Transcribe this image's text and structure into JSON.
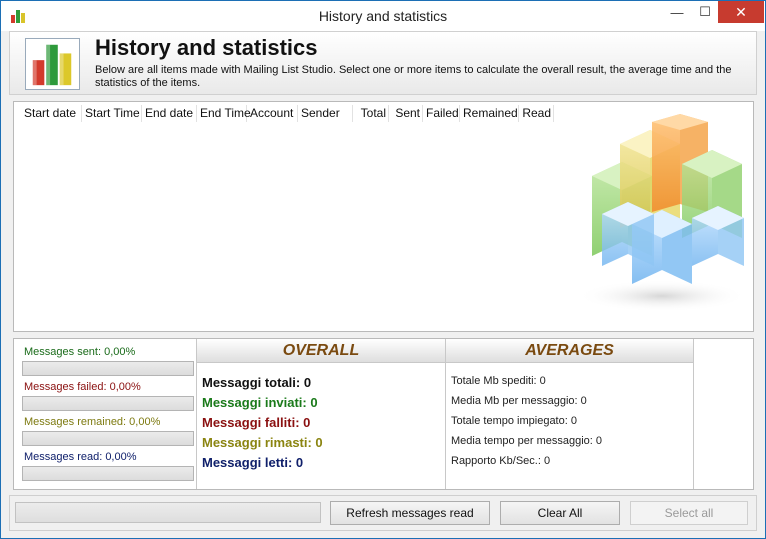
{
  "window": {
    "title": "History and statistics",
    "minimize": "—",
    "maximize": "☐",
    "close": "✕"
  },
  "header": {
    "title": "History and statistics",
    "description": "Below are all items made with Mailing List Studio. Select one or more items to calculate the overall result, the average time and the statistics of the items."
  },
  "table": {
    "columns": [
      "Start date",
      "Start Time",
      "End date",
      "End Time",
      "Account",
      "Sender",
      "Total",
      "Sent",
      "Failed",
      "Remained",
      "Read"
    ]
  },
  "progress": {
    "sent": {
      "label": "Messages sent: 0,00%",
      "value": 0,
      "color": "#1a6b1a"
    },
    "failed": {
      "label": "Messages failed: 0,00%",
      "value": 0,
      "color": "#8a1010"
    },
    "remained": {
      "label": "Messages remained: 0,00%",
      "value": 0,
      "color": "#7d7a10"
    },
    "read": {
      "label": "Messages read: 0,00%",
      "value": 0,
      "color": "#10206b"
    }
  },
  "overall": {
    "heading": "OVERALL",
    "totali": "Messaggi totali: 0",
    "inviati": "Messaggi inviati: 0",
    "falliti": "Messaggi falliti: 0",
    "rimasti": "Messaggi rimasti: 0",
    "letti": "Messaggi letti: 0",
    "colors": {
      "totali": "#111111",
      "inviati": "#1a7a1a",
      "falliti": "#8a1010",
      "rimasti": "#8a8410",
      "letti": "#10206b"
    }
  },
  "averages": {
    "heading": "AVERAGES",
    "mb_spediti": "Totale Mb spediti: 0",
    "mb_messaggio": "Media Mb per messaggio: 0",
    "tempo_impiegato": "Totale tempo impiegato: 0",
    "tempo_messaggio": "Media tempo per messaggio: 0",
    "rapporto": "Rapporto Kb/Sec.: 0"
  },
  "buttons": {
    "refresh": "Refresh messages read",
    "clear_all": "Clear All",
    "select_all": "Select all"
  }
}
